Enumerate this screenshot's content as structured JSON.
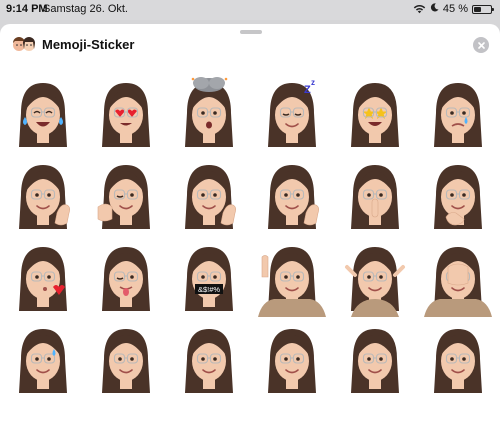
{
  "status_bar": {
    "time": "9:14 PM",
    "date": "Samstag 26. Okt.",
    "battery": "45 %",
    "battery_level": 0.45
  },
  "panel": {
    "title": "Memoji-Sticker",
    "header_icon": "memoji-faces-icon",
    "close_icon": "close-icon"
  },
  "stickers": [
    {
      "name": "tears-of-joy",
      "accessory": "tears"
    },
    {
      "name": "heart-eyes",
      "accessory": "hearts"
    },
    {
      "name": "mind-blown",
      "accessory": "cloud"
    },
    {
      "name": "sleeping",
      "accessory": "zzz"
    },
    {
      "name": "star-struck",
      "accessory": "stars"
    },
    {
      "name": "crying",
      "accessory": "tear"
    },
    {
      "name": "thumbs-up",
      "accessory": "hand-right"
    },
    {
      "name": "pointing",
      "accessory": "hand-left"
    },
    {
      "name": "peace-sign",
      "accessory": "hand-right"
    },
    {
      "name": "victory-wink",
      "accessory": "hand-right"
    },
    {
      "name": "shushing",
      "accessory": "hand-mouth"
    },
    {
      "name": "thinking",
      "accessory": "hand-chin"
    },
    {
      "name": "kissing",
      "accessory": "heart"
    },
    {
      "name": "winking-tongue",
      "accessory": "tongue"
    },
    {
      "name": "cursing",
      "accessory": "censor",
      "censor_text": "&$!#%"
    },
    {
      "name": "waving-hand",
      "accessory": "wave"
    },
    {
      "name": "shrugging",
      "accessory": "shrug"
    },
    {
      "name": "facepalm",
      "accessory": "facepalm"
    },
    {
      "name": "sweat-smile",
      "accessory": "sweat"
    },
    {
      "name": "surprised",
      "accessory": "none"
    },
    {
      "name": "frowning",
      "accessory": "none"
    },
    {
      "name": "grinning",
      "accessory": "none"
    },
    {
      "name": "neutral",
      "accessory": "none"
    },
    {
      "name": "smiling",
      "accessory": "none"
    }
  ],
  "colors": {
    "hair": "#4a3328",
    "skin": "#f2c9ad",
    "sheet": "#ffffff",
    "status_bg": "#d9d9db"
  }
}
